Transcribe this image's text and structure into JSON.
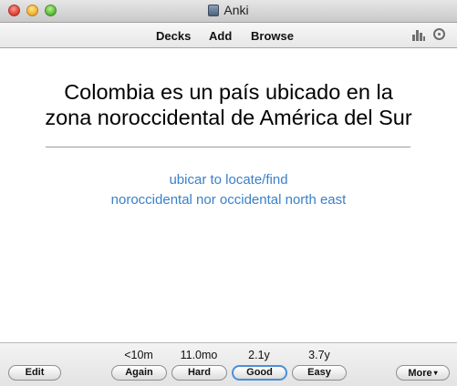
{
  "window": {
    "title": "Anki"
  },
  "toolbar": {
    "decks": "Decks",
    "add": "Add",
    "browse": "Browse"
  },
  "card": {
    "question_line1": "Colombia es un país ubicado en la",
    "question_line2": "zona noroccidental de América del Sur",
    "answer_lines": [
      "ubicar  to locate/find",
      "noroccidental  nor occidental  north east"
    ]
  },
  "bottom": {
    "edit": "Edit",
    "more": "More",
    "more_caret": "▾",
    "answers": [
      {
        "interval": "<10m",
        "label": "Again"
      },
      {
        "interval": "11.0mo",
        "label": "Hard"
      },
      {
        "interval": "2.1y",
        "label": "Good"
      },
      {
        "interval": "3.7y",
        "label": "Easy"
      }
    ]
  },
  "colors": {
    "answer_text": "#3a80c8",
    "default_button_ring": "#4a8fd8"
  },
  "icons": [
    "close-icon",
    "minimize-icon",
    "zoom-icon",
    "anki-app-icon",
    "stats-icon",
    "sync-icon"
  ]
}
